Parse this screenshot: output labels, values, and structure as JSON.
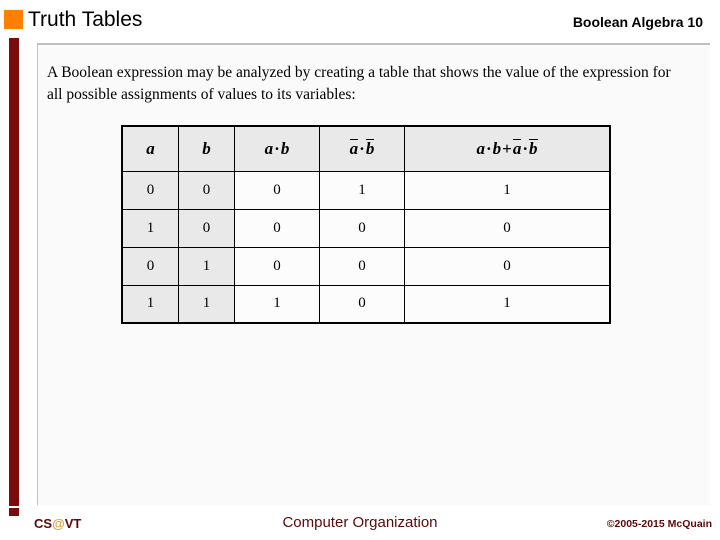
{
  "header": {
    "title": "Truth Tables",
    "subtitle": "Boolean Algebra 10",
    "bullet_color": "#FF7F00"
  },
  "accent": {
    "bar_color": "#7B0C0C",
    "panel_border_color": "#BFBFBF",
    "panel_background": "#FAFAFA"
  },
  "body": {
    "paragraph": "A Boolean expression may be analyzed by creating a table that shows the value of the expression for all possible assignments of values to its variables:"
  },
  "truth_table": {
    "columns": [
      {
        "key": "a",
        "label": "a",
        "type": "var",
        "overbar": false
      },
      {
        "key": "b",
        "label": "b",
        "type": "var",
        "overbar": false
      },
      {
        "key": "ab",
        "label": "a · b",
        "type": "expr"
      },
      {
        "key": "nanb",
        "label": "a̅ · b̅",
        "type": "expr"
      },
      {
        "key": "sum",
        "label": "a · b + a̅ · b̅",
        "type": "expr"
      }
    ],
    "rows": [
      {
        "a": "0",
        "b": "0",
        "ab": "0",
        "nanb": "1",
        "sum": "1"
      },
      {
        "a": "1",
        "b": "0",
        "ab": "0",
        "nanb": "0",
        "sum": "0"
      },
      {
        "a": "0",
        "b": "1",
        "ab": "0",
        "nanb": "0",
        "sum": "0"
      },
      {
        "a": "1",
        "b": "1",
        "ab": "1",
        "nanb": "0",
        "sum": "1"
      }
    ],
    "header_background": "#E9E9E9",
    "variable_column_background": "#E9E9E9",
    "cell_background": "#FCFCFC",
    "border_color": "#000000"
  },
  "footer": {
    "logo_prefix": "CS",
    "logo_at": "@",
    "logo_suffix": "VT",
    "center_text": "Computer Organization",
    "copyright": "©2005-2015 McQuain",
    "text_color": "#5A0A0A",
    "at_color": "#D9A441"
  }
}
